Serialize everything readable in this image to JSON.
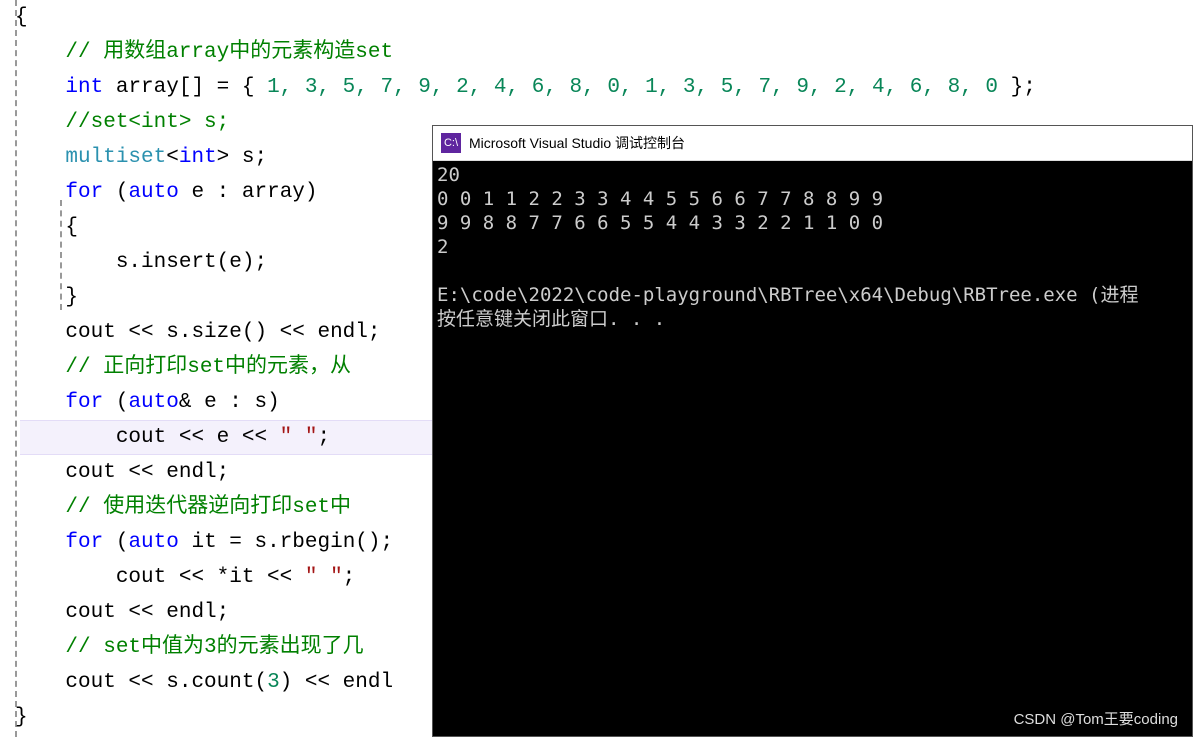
{
  "code": {
    "l0": "{",
    "l1_comment": "// 用数组array中的元素构造set",
    "l2_a": "int",
    "l2_b": " array[] = { ",
    "l2_nums": "1, 3, 5, 7, 9, 2, 4, 6, 8, 0, 1, 3, 5, 7, 9, 2, 4, 6, 8, 0",
    "l2_c": " };",
    "l3_comment": "//set<int> s;",
    "l4_a": "multiset",
    "l4_b": "<",
    "l4_c": "int",
    "l4_d": "> s;",
    "l5_a": "for",
    "l5_b": " (",
    "l5_c": "auto",
    "l5_d": " e : array)",
    "l6": "{",
    "l7_a": "s.insert(e);",
    "l8": "}",
    "l9_a": "cout << s.size() << endl;",
    "l10_comment": "// 正向打印set中的元素，从",
    "l11_a": "for",
    "l11_b": " (",
    "l11_c": "auto",
    "l11_d": "& e : s)",
    "l12_a": "cout << e << ",
    "l12_str": "\" \"",
    "l12_b": ";",
    "l13": "cout << endl;",
    "l14_comment": "// 使用迭代器逆向打印set中",
    "l15_a": "for",
    "l15_b": " (",
    "l15_c": "auto",
    "l15_d": " it = s.rbegin();",
    "l16_a": "cout << *it << ",
    "l16_str": "\" \"",
    "l16_b": ";",
    "l17": "cout << endl;",
    "l18_comment": "// set中值为3的元素出现了几",
    "l19_a": "cout << s.count(",
    "l19_num": "3",
    "l19_b": ") << endl",
    "l20": "}"
  },
  "console": {
    "title": "Microsoft Visual Studio 调试控制台",
    "line1": "20",
    "line2": "0 0 1 1 2 2 3 3 4 4 5 5 6 6 7 7 8 8 9 9",
    "line3": "9 9 8 8 7 7 6 6 5 5 4 4 3 3 2 2 1 1 0 0",
    "line4": "2",
    "line5": "",
    "line6": "E:\\code\\2022\\code-playground\\RBTree\\x64\\Debug\\RBTree.exe (进程 ",
    "line7": "按任意键关闭此窗口. . ."
  },
  "watermark": "CSDN @Tom王要coding"
}
